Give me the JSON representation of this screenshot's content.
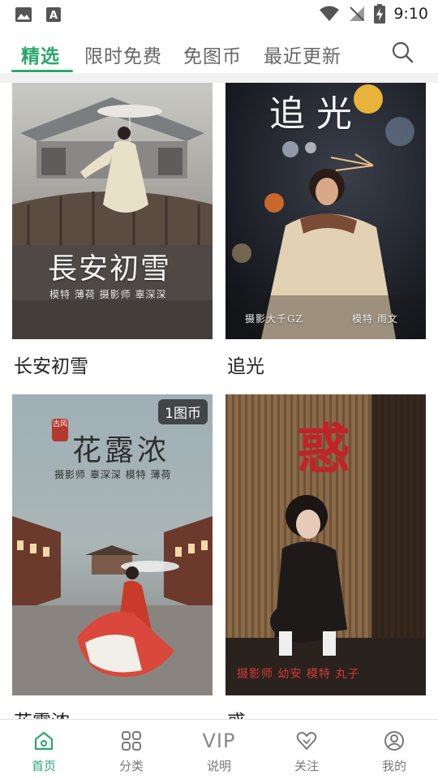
{
  "status_bar": {
    "time": "9:10",
    "icons": [
      "image-icon",
      "font-app-icon",
      "wifi-icon",
      "no-signal-icon",
      "battery-charging-icon"
    ]
  },
  "tabs": [
    {
      "label": "精选",
      "active": true
    },
    {
      "label": "限时免费",
      "active": false
    },
    {
      "label": "免图币",
      "active": false
    },
    {
      "label": "最近更新",
      "active": false
    }
  ],
  "accent_color": "#2aa86b",
  "cards": [
    {
      "title": "长安初雪",
      "poster_title": "長安初雪",
      "poster_credit": "模特 薄荷   摄影师 辜深深"
    },
    {
      "title": "追光",
      "poster_title": "追光",
      "poster_credit_left": "摄影大千GZ",
      "poster_credit_right": "模特 雨文"
    },
    {
      "title": "花露浓",
      "badge": "1图币",
      "poster_tag": "古风",
      "poster_title": "花露浓",
      "poster_credit": "摄影师 辜深深   模特 薄荷"
    },
    {
      "title": "惑",
      "poster_title": "惑",
      "poster_credit": "摄影师 幼安  模特 丸子"
    }
  ],
  "bottom_nav": [
    {
      "label": "首页",
      "icon": "home-icon",
      "active": true
    },
    {
      "label": "分类",
      "icon": "grid-icon",
      "active": false
    },
    {
      "label": "说明",
      "icon": "vip-icon",
      "icon_text": "VIP",
      "active": false
    },
    {
      "label": "关注",
      "icon": "heart-icon",
      "active": false
    },
    {
      "label": "我的",
      "icon": "profile-icon",
      "active": false
    }
  ]
}
